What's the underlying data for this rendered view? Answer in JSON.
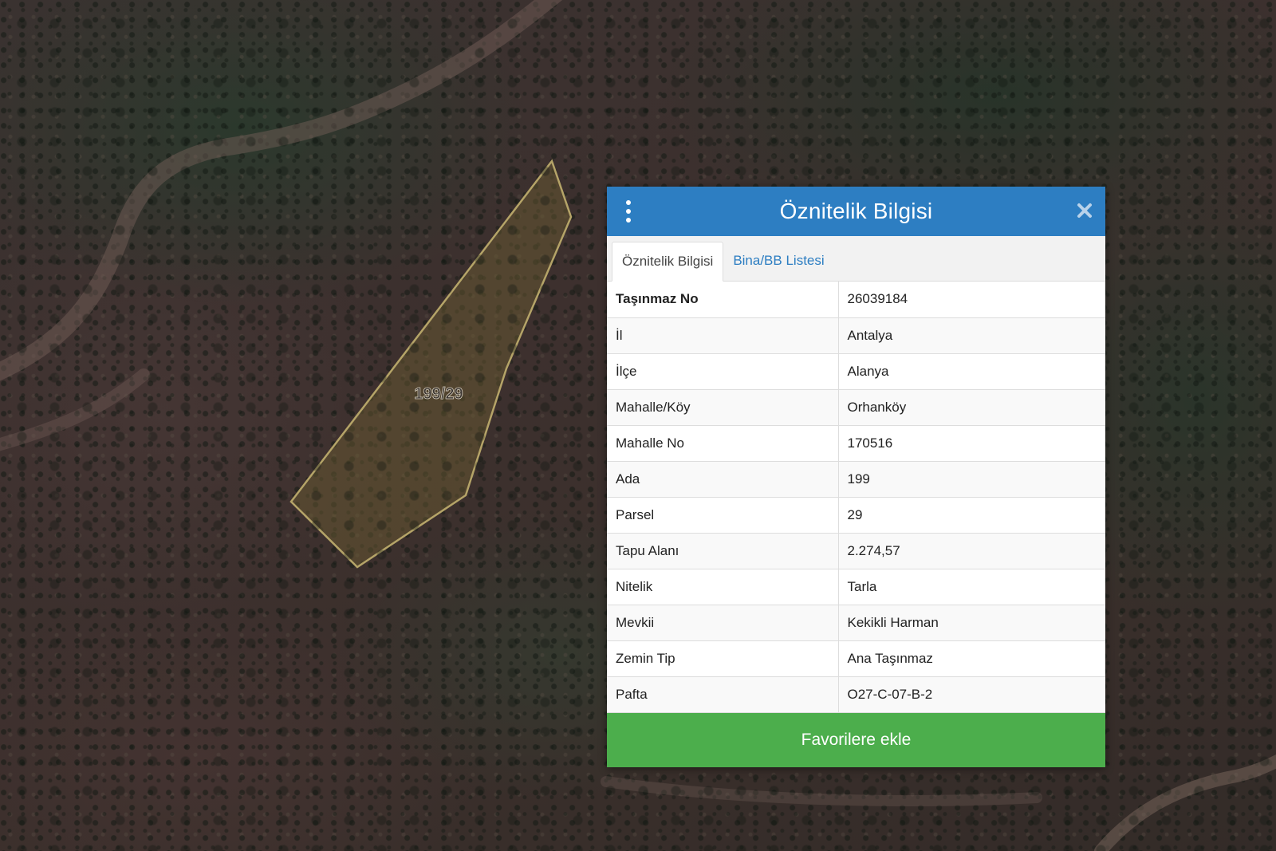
{
  "map": {
    "parcel_label": "199/29"
  },
  "panel": {
    "title": "Öznitelik Bilgisi",
    "tabs": [
      {
        "label": "Öznitelik Bilgisi",
        "active": true
      },
      {
        "label": "Bina/BB Listesi",
        "active": false
      }
    ],
    "rows": [
      {
        "key": "Taşınmaz No",
        "value": "26039184"
      },
      {
        "key": "İl",
        "value": "Antalya"
      },
      {
        "key": "İlçe",
        "value": "Alanya"
      },
      {
        "key": "Mahalle/Köy",
        "value": "Orhanköy"
      },
      {
        "key": "Mahalle No",
        "value": "170516"
      },
      {
        "key": "Ada",
        "value": "199"
      },
      {
        "key": "Parsel",
        "value": "29"
      },
      {
        "key": "Tapu Alanı",
        "value": "2.274,57"
      },
      {
        "key": "Nitelik",
        "value": "Tarla"
      },
      {
        "key": "Mevkii",
        "value": "Kekikli Harman"
      },
      {
        "key": "Zemin Tip",
        "value": "Ana Taşınmaz"
      },
      {
        "key": "Pafta",
        "value": "O27-C-07-B-2"
      }
    ],
    "favorite_button_label": "Favorilere ekle",
    "icons": {
      "menu": "vertical-dots-icon",
      "close": "close-icon"
    }
  },
  "colors": {
    "header": "#2d7ec2",
    "button": "#4cae4c",
    "parcel_outline": "#b5a468"
  }
}
